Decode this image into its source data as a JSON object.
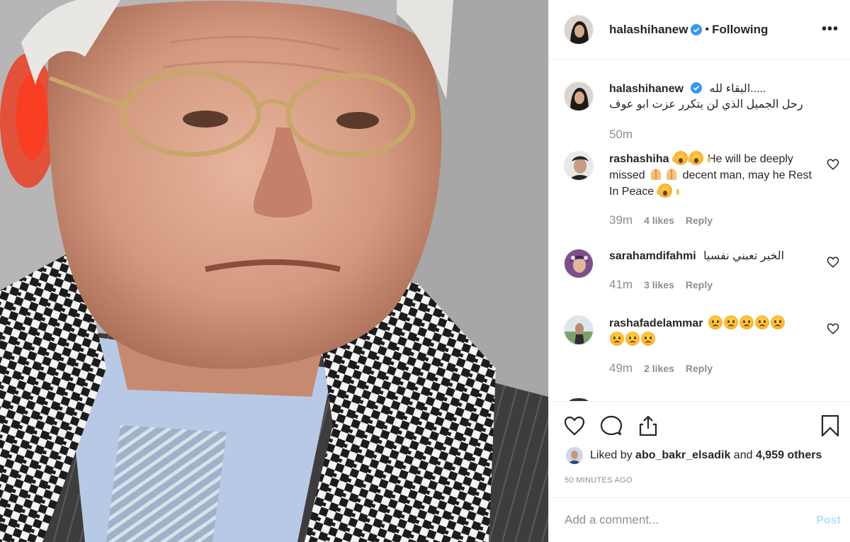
{
  "post": {
    "username": "halashihanew",
    "follow_status": "Following",
    "more_label": "•••",
    "caption_line1": ".....البقاء لله",
    "caption_line2": "رحل الجميل الذي لن يتكرر عزت ابو عوف",
    "caption_time": "50m"
  },
  "comments": [
    {
      "user": "rashashiha",
      "text_a": "He will be deeply missed",
      "text_b": "decent man, may he Rest In Peace",
      "time": "39m",
      "likes": "4 likes",
      "reply": "Reply"
    },
    {
      "user": "sarahamdifahmi",
      "text": "الخبر تعبني نفسيا",
      "time": "41m",
      "likes": "3 likes",
      "reply": "Reply"
    },
    {
      "user": "rashafadelammar",
      "time": "49m",
      "likes": "2 likes",
      "reply": "Reply"
    }
  ],
  "footer": {
    "liked_by_prefix": "Liked by",
    "liked_by_user": "abo_bakr_elsadik",
    "liked_by_and": "and",
    "liked_by_count": "4,959 others",
    "time_ago": "50 MINUTES AGO",
    "comment_placeholder": "Add a comment...",
    "post_label": "Post"
  },
  "icons": [
    "verified-badge-icon",
    "heart-icon",
    "comment-icon",
    "share-icon",
    "bookmark-icon",
    "more-icon"
  ],
  "colors": {
    "accent": "#3897f0",
    "post_disabled": "#b2dffc",
    "muted": "#8e8e8e"
  }
}
